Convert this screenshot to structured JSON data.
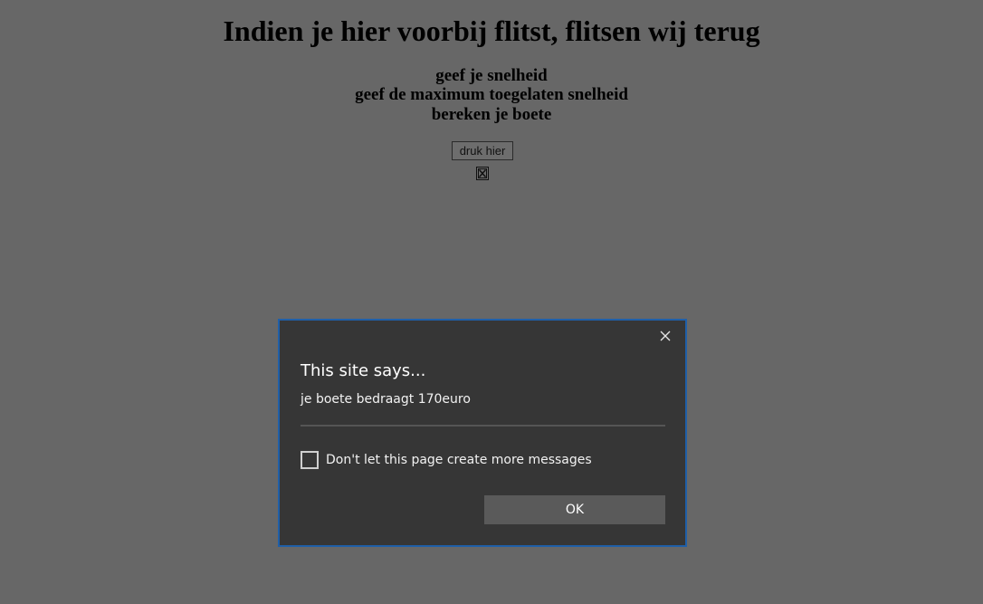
{
  "page": {
    "title": "Indien je hier voorbij flitst, flitsen wij terug",
    "lines": [
      "geef je snelheid",
      "geef de maximum toegelaten snelheid",
      "bereken je boete"
    ],
    "button_label": "druk hier",
    "broken_image_icon": "broken-image-icon"
  },
  "dialog": {
    "title": "This site says...",
    "message": "je boete bedraagt 170euro",
    "checkbox_label": "Don't let this page create more messages",
    "checkbox_checked": false,
    "ok_label": "OK",
    "close_icon": "close-icon"
  },
  "colors": {
    "overlay_background": "#676767",
    "dialog_background": "#363636",
    "dialog_border": "#1f5fa8",
    "ok_button": "#5a5a5a"
  }
}
